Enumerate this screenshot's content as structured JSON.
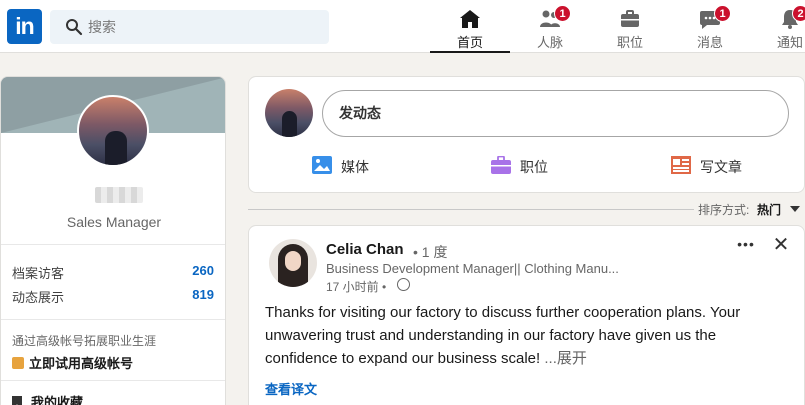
{
  "header": {
    "logo_text": "in",
    "search": {
      "placeholder": "搜索"
    },
    "nav": [
      {
        "label": "首页",
        "icon": "home-icon",
        "active": true,
        "badge": ""
      },
      {
        "label": "人脉",
        "icon": "people-icon",
        "active": false,
        "badge": "1"
      },
      {
        "label": "职位",
        "icon": "briefcase-icon",
        "active": false,
        "badge": ""
      },
      {
        "label": "消息",
        "icon": "messaging-icon",
        "active": false,
        "badge": "1"
      },
      {
        "label": "通知",
        "icon": "bell-icon",
        "active": false,
        "badge": "2"
      }
    ]
  },
  "profile": {
    "headline": "Sales Manager",
    "stats": [
      {
        "label": "档案访客",
        "value": "260"
      },
      {
        "label": "动态展示",
        "value": "819"
      }
    ],
    "promo_text": "通过高级帐号拓展职业生涯",
    "promo_link": "立即试用高级帐号",
    "saved_label": "我的收藏"
  },
  "share": {
    "start_post": "发动态",
    "actions": [
      {
        "label": "媒体",
        "icon": "image-icon",
        "color": "#378fe9"
      },
      {
        "label": "职位",
        "icon": "briefcase-icon",
        "color": "#a872e8"
      },
      {
        "label": "写文章",
        "icon": "article-icon",
        "color": "#e06847"
      }
    ]
  },
  "sort": {
    "label": "排序方式:",
    "value": "热门"
  },
  "post": {
    "author": "Celia Chan",
    "degree": "• 1 度",
    "subtitle": "Business Development Manager|| Clothing Manu...",
    "time": "17 小时前 •",
    "body": "Thanks for visiting our factory to discuss further cooperation plans. Your unwavering trust and understanding in our factory have given us the confidence to expand our business scale!",
    "see_more": "...展开",
    "translate": "查看译文"
  },
  "colors": {
    "brand": "#0a66c2",
    "badge": "#cb112d",
    "background": "#f4f2ee"
  }
}
